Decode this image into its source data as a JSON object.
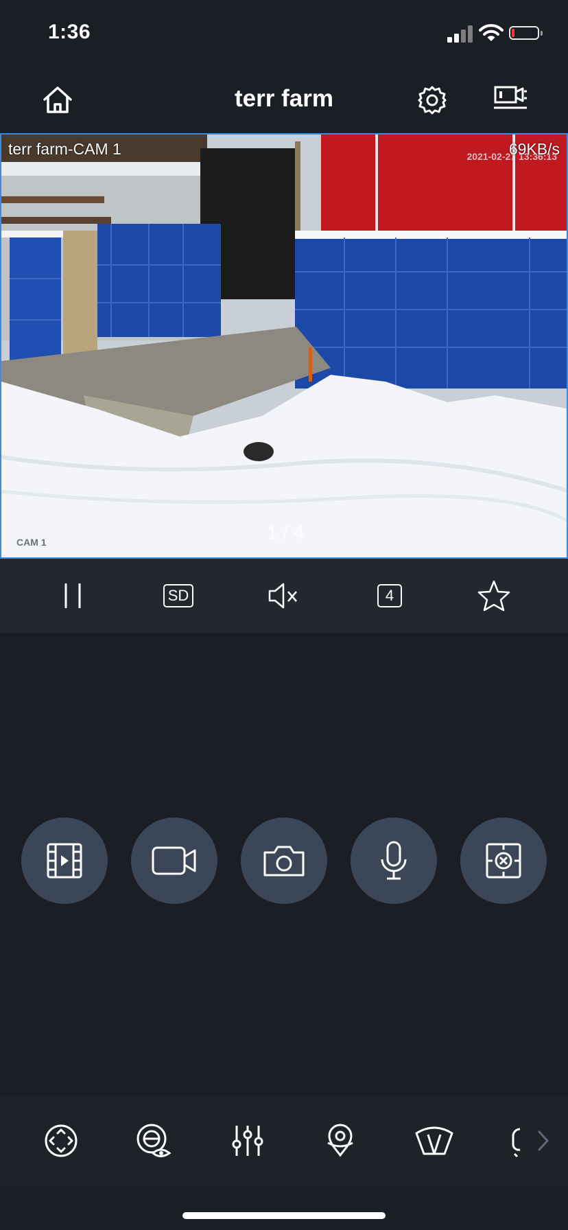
{
  "status": {
    "time": "1:36"
  },
  "header": {
    "title": "terr farm"
  },
  "video": {
    "camera_name": "terr farm-CAM 1",
    "bitrate": "69KB/s",
    "timestamp": "2021-02-27 13:36:13",
    "pager": "1 / 4",
    "watermark": "CAM 1"
  },
  "controls": {
    "quality": "SD",
    "split_count": "4"
  },
  "colors": {
    "accent": "#3a8ce0",
    "circle": "#3b4656",
    "background": "#1b1e24",
    "battery_low": "#ff3b30"
  }
}
